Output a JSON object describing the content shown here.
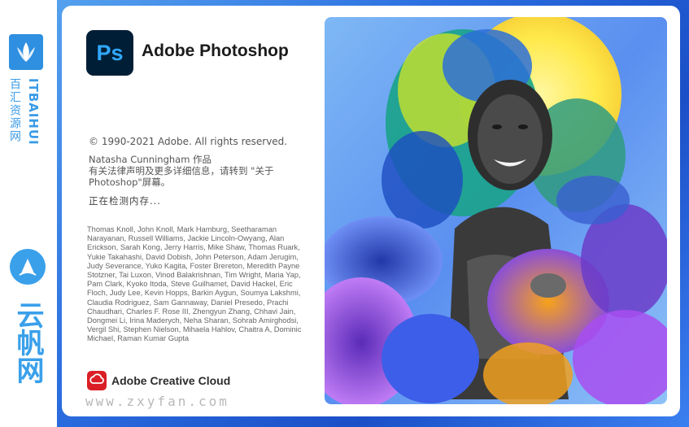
{
  "watermark": {
    "brand_en": "ITBAIHUI",
    "brand_zh": "百汇资源网",
    "yun_text": "云帆网",
    "site_url": "www.zxyfan.com"
  },
  "splash": {
    "app_logo_text": "Ps",
    "app_title": "Adobe Photoshop",
    "copyright": "© 1990-2021 Adobe. All rights reserved.",
    "artwork_by": "Natasha Cunningham 作品",
    "legal_note": "有关法律声明及更多详细信息，请转到 \"关于 Photoshop\"屏幕。",
    "status": "正在检测内存...",
    "credits": "Thomas Knoll, John Knoll, Mark Hamburg, Seetharaman Narayanan, Russell Williams, Jackie Lincoln-Owyang, Alan Erickson, Sarah Kong, Jerry Harris, Mike Shaw, Thomas Ruark, Yukie Takahashi, David Dobish, John Peterson, Adam Jerugim, Judy Severance, Yuko Kagita, Foster Brereton, Meredith Payne Stotzner, Tai Luxon, Vinod Balakrishnan, Tim Wright, Maria Yap, Pam Clark, Kyoko Itoda, Steve Guilhamet, David Hackel, Eric Floch, Judy Lee, Kevin Hopps, Barkin Aygun, Soumya Lakshmi, Claudia Rodriguez, Sam Gannaway, Daniel Presedo, Prachi Chaudhari, Charles F. Rose III, Zhengyun Zhang, Chhavi Jain, Dongmei Li, Irina Maderych, Neha Sharan, Sohrab Amirghodsi, Vergil Shi, Stephen Nielson, Mihaela Hahlov, Chaitra A, Dominic Michael, Raman Kumar Gupta",
    "cc_label": "Adobe Creative Cloud"
  },
  "colors": {
    "ps_bg": "#001e36",
    "ps_text": "#31a8ff",
    "watermark_blue": "#3a9be6"
  }
}
